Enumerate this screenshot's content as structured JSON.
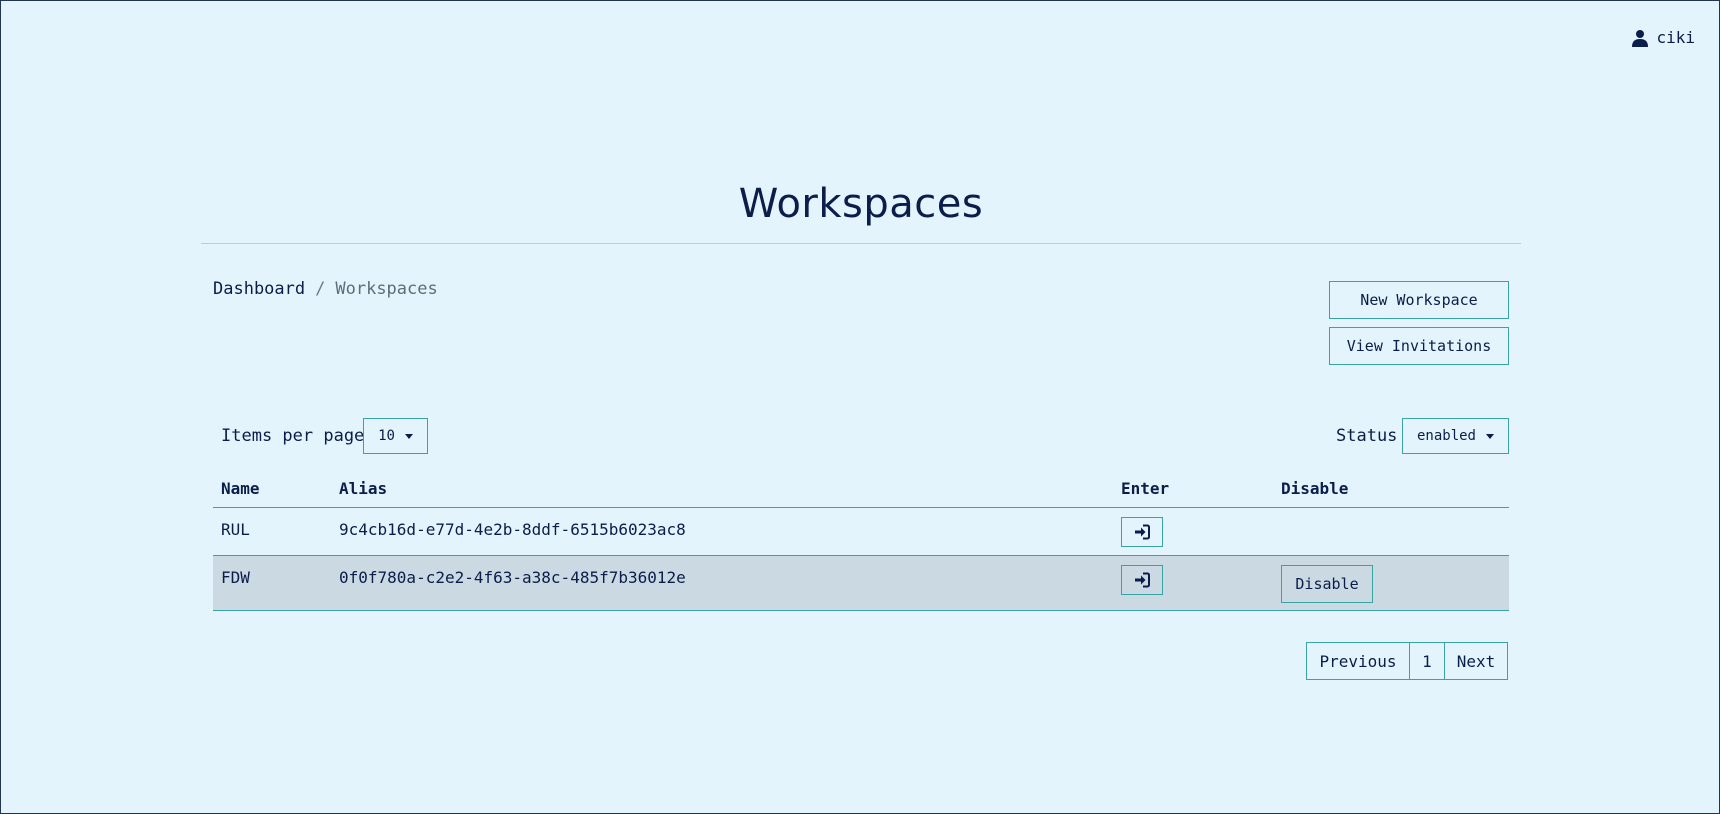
{
  "header": {
    "user_name": "ciki",
    "user_icon": "user-icon"
  },
  "page": {
    "title": "Workspaces"
  },
  "breadcrumb": {
    "home": "Dashboard",
    "separator": "/",
    "current": "Workspaces"
  },
  "actions": {
    "new_workspace": "New Workspace",
    "view_invitations": "View Invitations"
  },
  "filters": {
    "items_per_page_label": "Items per page",
    "items_per_page_value": "10",
    "status_label": "Status",
    "status_value": "enabled"
  },
  "table": {
    "headers": {
      "name": "Name",
      "alias": "Alias",
      "enter": "Enter",
      "disable": "Disable"
    },
    "rows": [
      {
        "name": "RUL",
        "alias": "9c4cb16d-e77d-4e2b-8ddf-6515b6023ac8",
        "disable_label": ""
      },
      {
        "name": "FDW",
        "alias": "0f0f780a-c2e2-4f63-a38c-485f7b36012e",
        "disable_label": "Disable"
      }
    ],
    "enter_icon": "sign-in-icon"
  },
  "pagination": {
    "previous": "Previous",
    "current_page": "1",
    "next": "Next"
  },
  "colors": {
    "background": "#e4f4fd",
    "text": "#0b1d4a",
    "accent_border": "#3aa3a3",
    "selected_row": "#cbd9e3"
  }
}
